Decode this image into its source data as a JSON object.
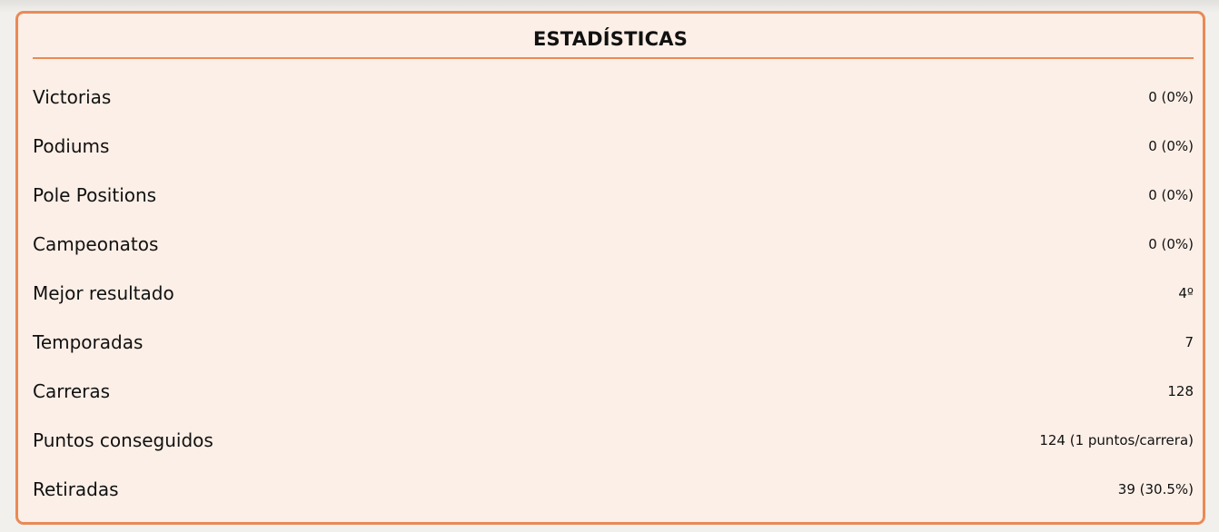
{
  "stats": {
    "title": "ESTADÍSTICAS",
    "rows": [
      {
        "label": "Victorias",
        "value": "0 (0%)"
      },
      {
        "label": "Podiums",
        "value": "0 (0%)"
      },
      {
        "label": "Pole Positions",
        "value": "0 (0%)"
      },
      {
        "label": "Campeonatos",
        "value": "0 (0%)"
      },
      {
        "label": "Mejor resultado",
        "value": "4º"
      },
      {
        "label": "Temporadas",
        "value": "7"
      },
      {
        "label": "Carreras",
        "value": "128"
      },
      {
        "label": "Puntos conseguidos",
        "value": "124 (1 puntos/carrera)"
      },
      {
        "label": "Retiradas",
        "value": "39 (30.5%)"
      }
    ]
  },
  "colors": {
    "accent": "#ea8a55",
    "card_background": "#fcefe7",
    "page_background": "#f2f0ed",
    "text": "#111111"
  }
}
